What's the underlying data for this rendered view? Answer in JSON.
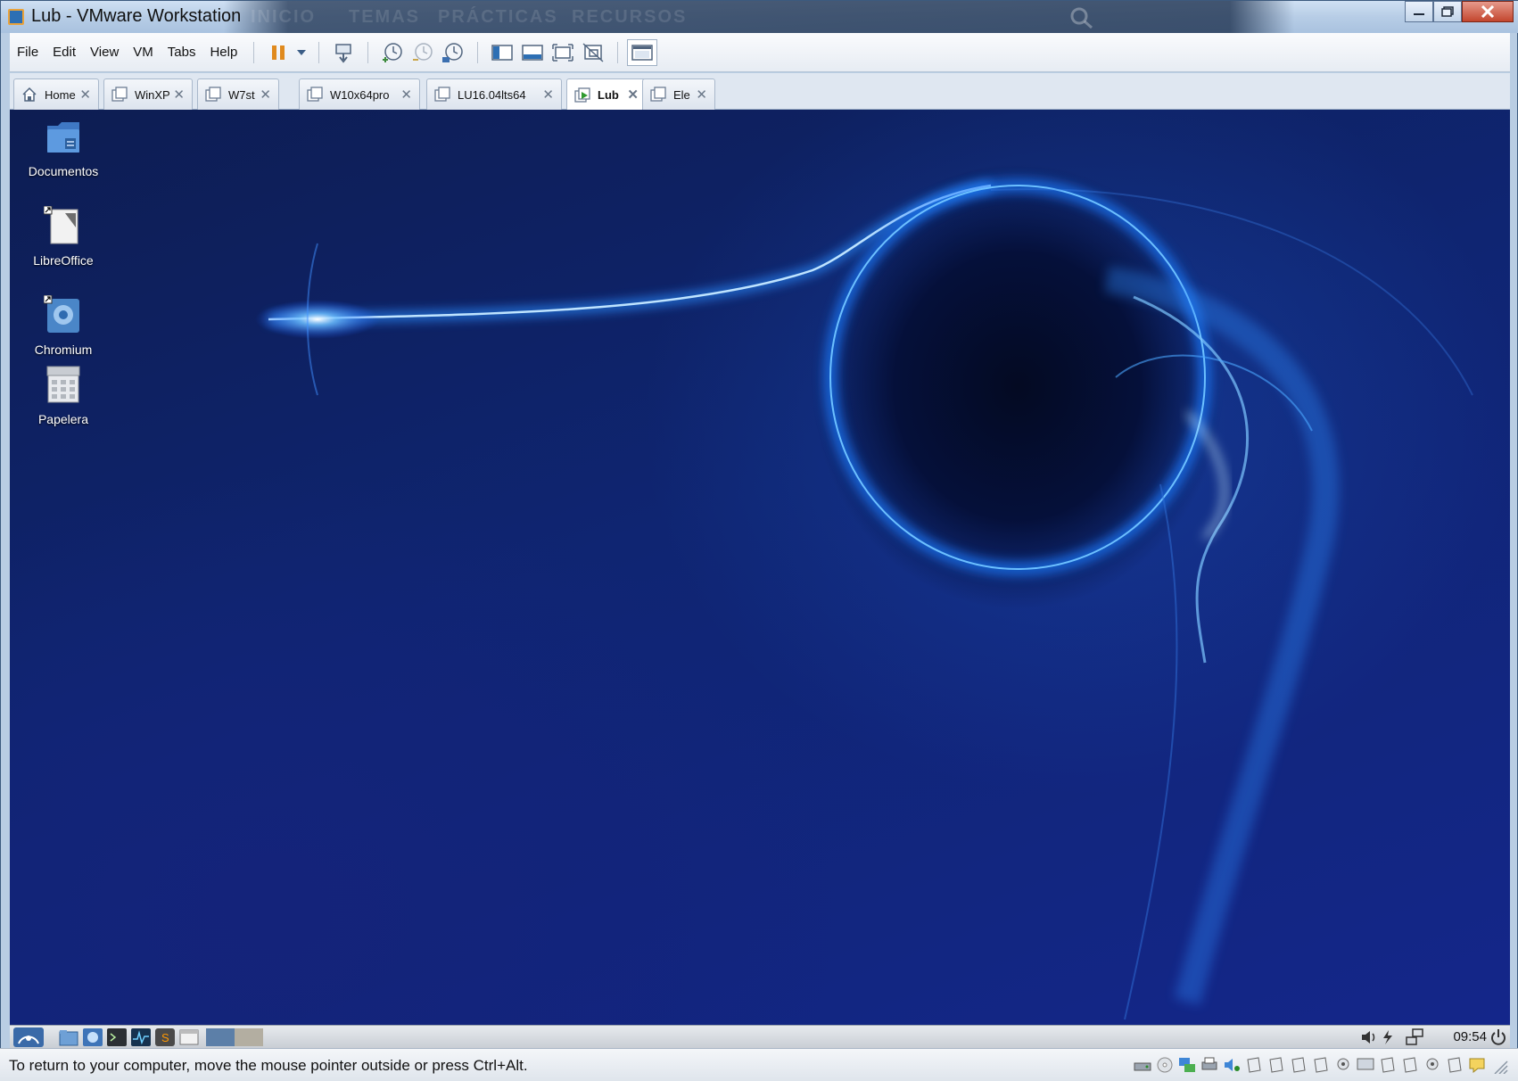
{
  "window": {
    "title": "Lub - VMware Workstation",
    "banner_ghost": [
      "INICIO",
      "TEMAS",
      "PRÁCTICAS",
      "RECURSOS"
    ]
  },
  "menubar": {
    "items": [
      "File",
      "Edit",
      "View",
      "VM",
      "Tabs",
      "Help"
    ]
  },
  "tabs": [
    {
      "label": "Home",
      "active": false
    },
    {
      "label": "WinXP",
      "active": false
    },
    {
      "label": "W7st",
      "active": false
    },
    {
      "label": "W10x64pro",
      "active": false
    },
    {
      "label": "LU16.04lts64",
      "active": false
    },
    {
      "label": "Lub",
      "active": true
    },
    {
      "label": "Ele",
      "active": false
    }
  ],
  "desktop": {
    "icons": [
      {
        "label": "Documentos",
        "icon": "folder-icon"
      },
      {
        "label": "LibreOffice",
        "icon": "document-icon"
      },
      {
        "label": "Chromium",
        "icon": "chromium-icon"
      },
      {
        "label": "Papelera",
        "icon": "trash-icon"
      }
    ]
  },
  "taskbar": {
    "clock": "09:54"
  },
  "statusbar": {
    "message": "To return to your computer, move the mouse pointer outside or press Ctrl+Alt."
  },
  "colors": {
    "accent": "#2d6fb4",
    "pause": "#e08a1e",
    "desktop_bg": "#0f2572"
  }
}
